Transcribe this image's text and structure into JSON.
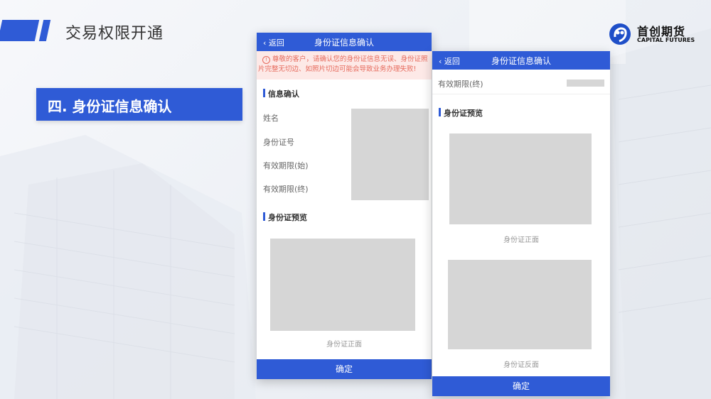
{
  "slide": {
    "title": "交易权限开通",
    "section": "四. 身份证信息确认"
  },
  "logo": {
    "name_cn": "首创期货",
    "name_en": "CAPITAL FUTURES"
  },
  "colors": {
    "accent": "#2f5bd6",
    "warning_bg": "#fde9e7",
    "warning_text": "#e66a5c",
    "placeholder": "#d6d6d6"
  },
  "phone1": {
    "back": "返回",
    "header": "身份证信息确认",
    "warning": "尊敬的客户，请确认您的身份证信息无误、身份证照片完整无切边、如照片切边可能会导致业务办理失败!",
    "info_section": "信息确认",
    "fields": [
      "姓名",
      "身份证号",
      "有效期限(始)",
      "有效期限(终)"
    ],
    "preview_section": "身份证预览",
    "front_caption": "身份证正面",
    "confirm": "确定"
  },
  "phone2": {
    "back": "返回",
    "header": "身份证信息确认",
    "field": "有效期限(终)",
    "preview_section": "身份证预览",
    "front_caption": "身份证正面",
    "back_caption": "身份证反面",
    "confirm": "确定"
  }
}
